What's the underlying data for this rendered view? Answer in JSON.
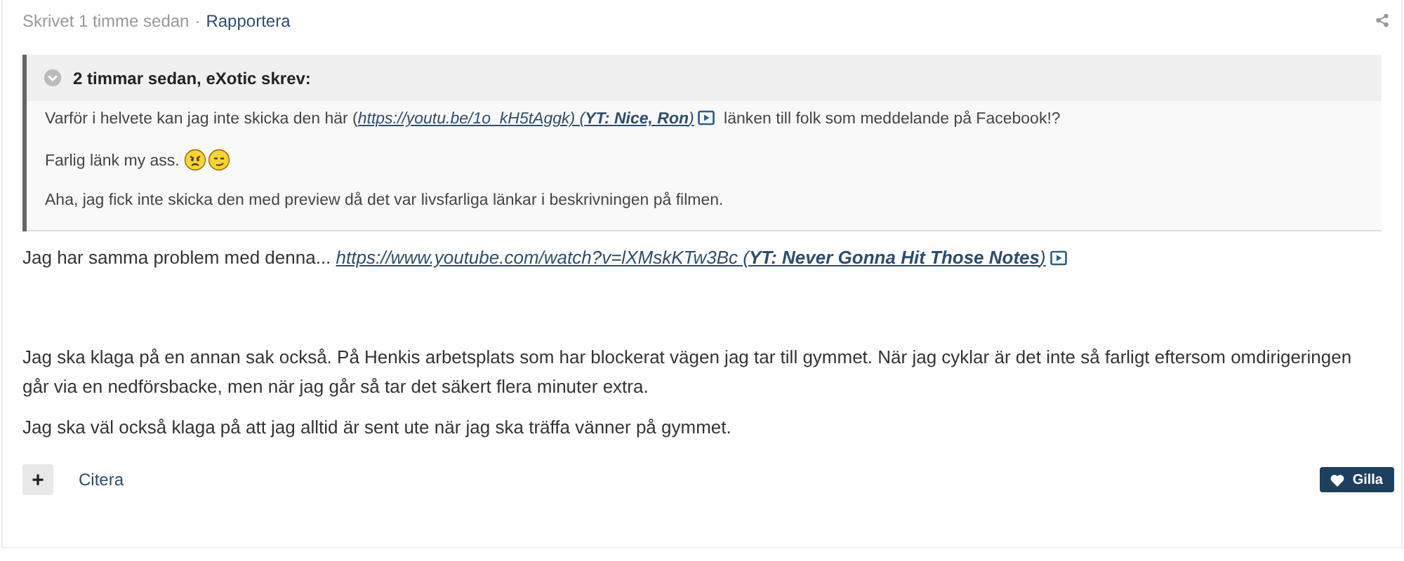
{
  "post_meta": {
    "posted": "Skrivet 1 timme sedan",
    "separator": "·",
    "report_link": "Rapportera"
  },
  "quote": {
    "header": "2 timmar sedan, eXotic skrev:",
    "paragraphs": [
      [
        {
          "kind": "text",
          "text": "Varför i helvete kan jag inte skicka den här ("
        },
        {
          "kind": "link",
          "text": "https://youtu.be/1o_kH5tAggk) (**YT: Nice, Ron**)"
        },
        {
          "kind": "video"
        },
        {
          "kind": "text",
          "text": " länken till folk som meddelande på Facebook!?"
        }
      ],
      [
        {
          "kind": "text",
          "text": "Farlig länk my ass. "
        },
        {
          "kind": "frown"
        },
        {
          "kind": "smirk"
        }
      ],
      [
        {
          "kind": "text",
          "text": "Aha, jag fick inte skicka den med preview då det var livsfarliga länkar i beskrivningen på filmen."
        }
      ]
    ]
  },
  "body": [
    [
      {
        "kind": "text",
        "text": "Jag har samma problem med denna... "
      },
      {
        "kind": "link",
        "text": "https://www.youtube.com/watch?v=lXMskKTw3Bc (**YT: Never Gonna Hit Those Notes**)"
      },
      {
        "kind": "video"
      }
    ],
    [
      {
        "kind": "gap"
      }
    ],
    [
      {
        "kind": "text",
        "text": "Jag ska klaga på en annan sak också. På Henkis arbetsplats som har blockerat vägen jag tar till gymmet. När jag cyklar är det inte så farligt eftersom omdirigeringen går via en nedförsbacke, men när jag går så tar det säkert flera minuter extra."
      }
    ],
    [
      {
        "kind": "text",
        "text": "Jag ska väl också klaga på att jag alltid är sent ute när jag ska träffa vänner på gymmet."
      }
    ]
  ],
  "actions": {
    "add_symbol": "+",
    "quote_link": "Citera",
    "like_label": "Gilla"
  }
}
